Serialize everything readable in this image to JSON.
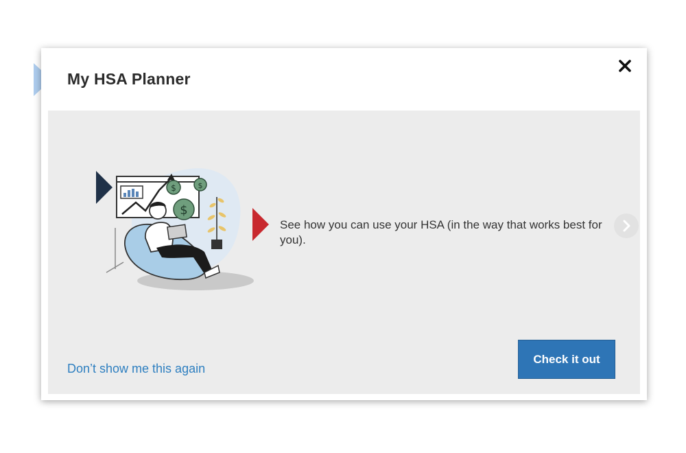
{
  "dialog": {
    "title": "My HSA Planner",
    "close_icon": "close-icon"
  },
  "slide": {
    "illustration": "person-with-laptop-on-beanbag-illustration",
    "description": "See how you can use your HSA (in the way that works best for you).",
    "next_icon": "chevron-right-icon"
  },
  "footer": {
    "dismiss_link": "Don’t show me this again",
    "cta_button": "Check it out"
  },
  "colors": {
    "accent_blue": "#2e75b6",
    "link_blue": "#2e7fc0",
    "marker_light_blue": "#aecdee",
    "marker_navy": "#1f3148",
    "marker_red": "#c8282e",
    "panel_gray": "#ececec"
  }
}
